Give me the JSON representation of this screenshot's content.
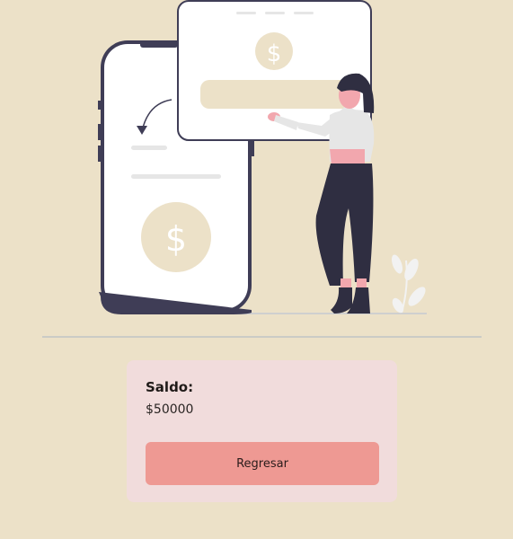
{
  "illustration": {
    "icon": "payment-illustration",
    "dollar_symbol": "$"
  },
  "balance": {
    "label": "Saldo:",
    "value": "$50000"
  },
  "actions": {
    "back_label": "Regresar"
  },
  "colors": {
    "background": "#ece1c8",
    "card": "#f1dcdc",
    "button": "#ee9993",
    "divider": "#cbcbc6"
  }
}
